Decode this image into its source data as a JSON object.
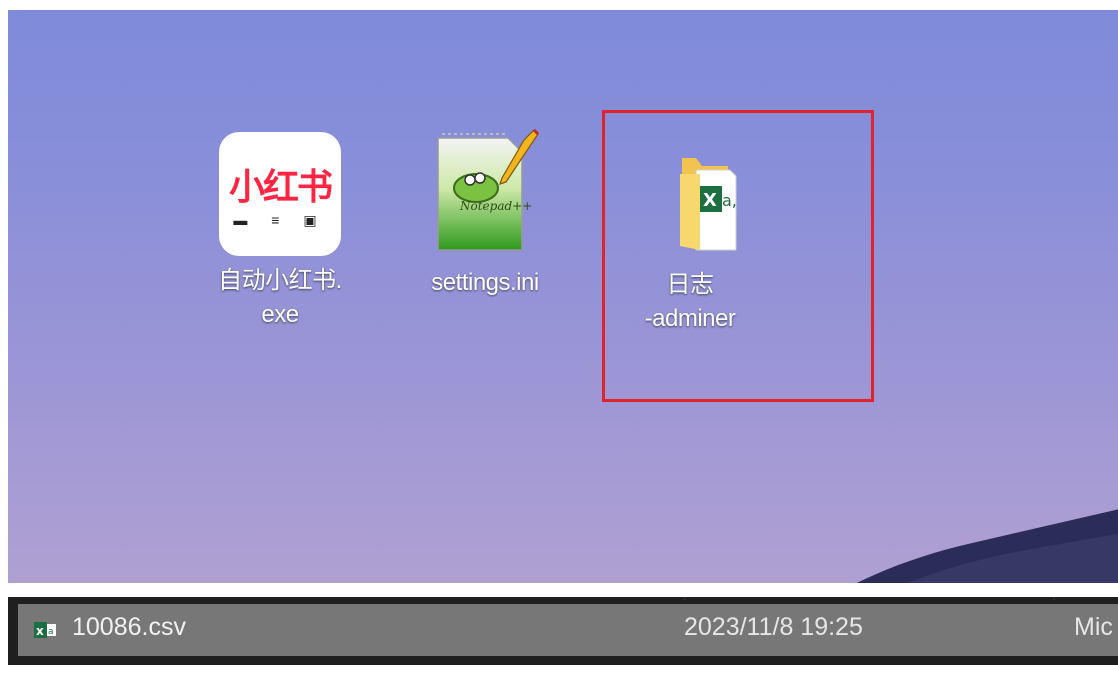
{
  "desktop": {
    "icons": [
      {
        "label": "自动小红书.\nexe",
        "tile_brand": "小红书",
        "tile_glyphs": "▬ ≡ ▣"
      },
      {
        "label": "settings.ini"
      },
      {
        "label": "日志\n-adminer"
      }
    ],
    "highlight_color": "#e0242b"
  },
  "file_list": {
    "row": {
      "icon": "excel-csv-icon",
      "name": "10086.csv",
      "modified": "2023/11/8 19:25",
      "type": "Mic"
    }
  },
  "colors": {
    "brand_red": "#ff2442",
    "excel_green": "#1d6f42"
  }
}
